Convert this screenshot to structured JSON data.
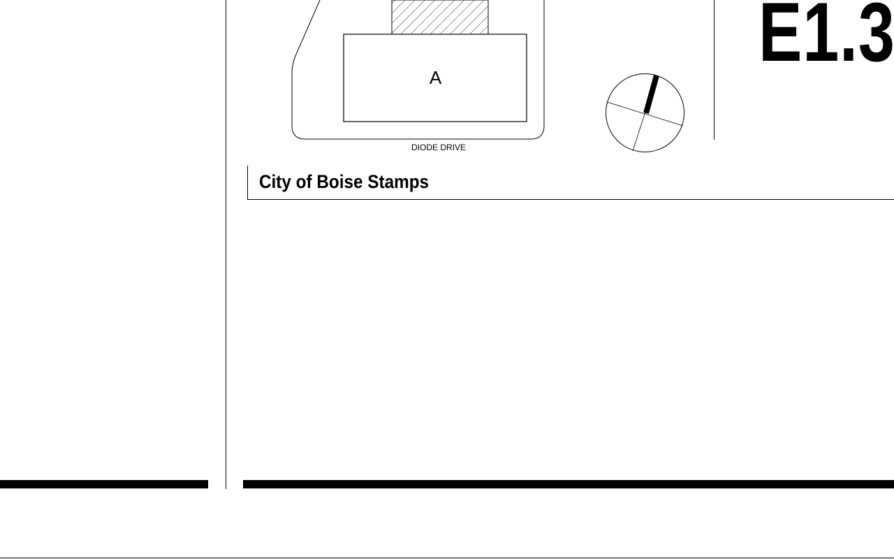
{
  "sheet": {
    "number": "E1.3"
  },
  "site_plan": {
    "building_label": "A",
    "street_label": "DIODE DRIVE"
  },
  "stamps": {
    "title": "City of Boise Stamps"
  },
  "colors": {
    "line": "#000000",
    "background": "#ffffff"
  },
  "icons": {
    "north_arrow": "north-arrow-icon",
    "hatch": "hatched-area"
  }
}
